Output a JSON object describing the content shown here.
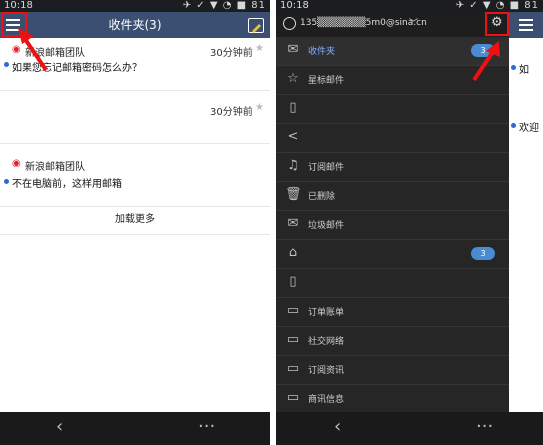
{
  "status_left": {
    "time": "10:18",
    "icons": "✈ ✓ ▼ ◔ ■ 81"
  },
  "status_right": {
    "time": "10:18",
    "icons": "✈ ✓ ▼ ◔ ■ 81"
  },
  "left_screen": {
    "toolbar": {
      "title": "收件夹(3)"
    },
    "messages": [
      {
        "sender": "新浪邮箱团队",
        "time": "30分钟前",
        "preview": "如果您忘记邮箱密码怎么办？"
      },
      {
        "sender": "",
        "time": "30分钟前",
        "preview": ""
      },
      {
        "sender": "新浪邮箱团队",
        "time": "",
        "preview": "不在电脑前，这样用邮箱"
      }
    ],
    "load_more": "加载更多"
  },
  "right_screen": {
    "header": {
      "account": "135▒▒▒▒▒▒▒5m0@sina.cn"
    },
    "drawer": [
      {
        "label": "收件夹",
        "icon": "envelope-icon",
        "badge": "3",
        "badge_highlight": true
      },
      {
        "label": "星标邮件",
        "icon": "star-icon",
        "badge": ""
      },
      {
        "label": "",
        "icon": "document-icon",
        "badge": ""
      },
      {
        "label": "",
        "icon": "send-icon",
        "badge": ""
      },
      {
        "label": "订阅邮件",
        "icon": "bell-icon",
        "badge": ""
      },
      {
        "label": "已删除",
        "icon": "trash-icon",
        "badge": ""
      },
      {
        "label": "垃圾邮件",
        "icon": "spam-envelope-icon",
        "badge": ""
      },
      {
        "label": "",
        "icon": "clip-icon",
        "badge": "3"
      },
      {
        "label": "",
        "icon": "doc-outline-icon",
        "badge": ""
      },
      {
        "label": "订单账单",
        "icon": "folder-icon",
        "badge": ""
      },
      {
        "label": "社交网络",
        "icon": "folder-icon",
        "badge": ""
      },
      {
        "label": "订阅资讯",
        "icon": "folder-icon",
        "badge": ""
      },
      {
        "label": "商讯信息",
        "icon": "folder-icon",
        "badge": ""
      }
    ],
    "peek": {
      "preview_1": "如",
      "preview_2": "欢迎"
    }
  },
  "navbar": {
    "back": "‹",
    "more": "···"
  },
  "colors": {
    "toolbar": "#3b4f73",
    "drawer": "#262626",
    "highlight": "#e11111",
    "badge": "#4b8bd1"
  }
}
